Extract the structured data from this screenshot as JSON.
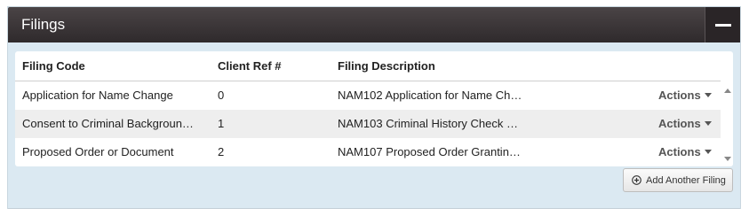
{
  "panel": {
    "title": "Filings",
    "collapse_icon": "minus-icon"
  },
  "table": {
    "columns": [
      "Filing Code",
      "Client Ref #",
      "Filing Description"
    ],
    "rows": [
      {
        "code": "Application for Name Change",
        "client_ref": "0",
        "description": "NAM102 Application for Name Ch…",
        "action_label": "Actions"
      },
      {
        "code": "Consent to Criminal Background …",
        "client_ref": "1",
        "description": "NAM103 Criminal History Check …",
        "action_label": "Actions"
      },
      {
        "code": "Proposed Order or Document",
        "client_ref": "2",
        "description": "NAM107 Proposed Order Grantin…",
        "action_label": "Actions"
      }
    ]
  },
  "add_button": {
    "label": "Add Another Filing",
    "icon": "plus-circle-icon"
  },
  "colors": {
    "header_bg": "#3a3436",
    "panel_bg": "#dbe9f2",
    "row_alt_bg": "#eeeeee"
  }
}
